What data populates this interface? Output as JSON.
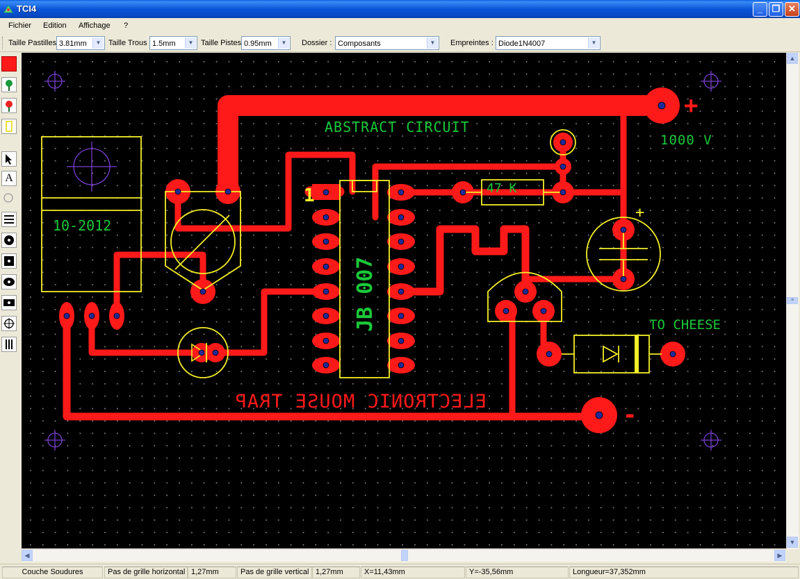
{
  "window": {
    "title": "TCI4"
  },
  "menu": [
    "Fichier",
    "Edition",
    "Affichage",
    "?"
  ],
  "toolbar": {
    "pad_size_label": "Taille Pastilles",
    "pad_size_value": "3.81mm",
    "hole_size_label": "Taille Trous",
    "hole_size_value": "1.5mm",
    "track_size_label": "Taille Pistes",
    "track_size_value": "0.95mm",
    "folder_label": "Dossier :",
    "folder_value": "Composants",
    "footprint_label": "Empreintes :",
    "footprint_value": "Diode1N4007"
  },
  "tools": [
    "red-square-icon",
    "green-pin-icon",
    "red-pin-icon",
    "yellow-rect-icon",
    "arrow-select-icon",
    "text-icon",
    "circle-icon",
    "lines-icon",
    "round-pad-icon",
    "square-pad-icon",
    "oval-pad-icon",
    "rect-pad-icon",
    "target-icon",
    "grid-icon"
  ],
  "pcb": {
    "colors": {
      "copper": "#ff1a1a",
      "silkscreen": "#f5ef27",
      "text_green": "#19c93a",
      "crosshair": "#7a3fd0",
      "hole": "#1f2a9a"
    },
    "texts": {
      "abstract_circuit": "ABSTRACT CIRCUIT",
      "voltage": "1000 V",
      "resistor_value": "47 K",
      "regulator_date": "10-2012",
      "ic_label": "JB 007",
      "pin_one": "1",
      "to_cheese": "TO CHEESE",
      "mirrored_title": "ELECTRONIC MOUSE TRAP",
      "plus_sign": "+",
      "minus_sign": "-",
      "cap_plus": "+"
    }
  },
  "status": {
    "layer": "Couche Soudures",
    "h_grid_label": "Pas de grille horizontal :",
    "h_grid_value": "1,27mm",
    "v_grid_label": "Pas de grille vertical :",
    "v_grid_value": "1,27mm",
    "x": "X=11,43mm",
    "y": "Y=-35,56mm",
    "length": "Longueur=37,352mm"
  }
}
